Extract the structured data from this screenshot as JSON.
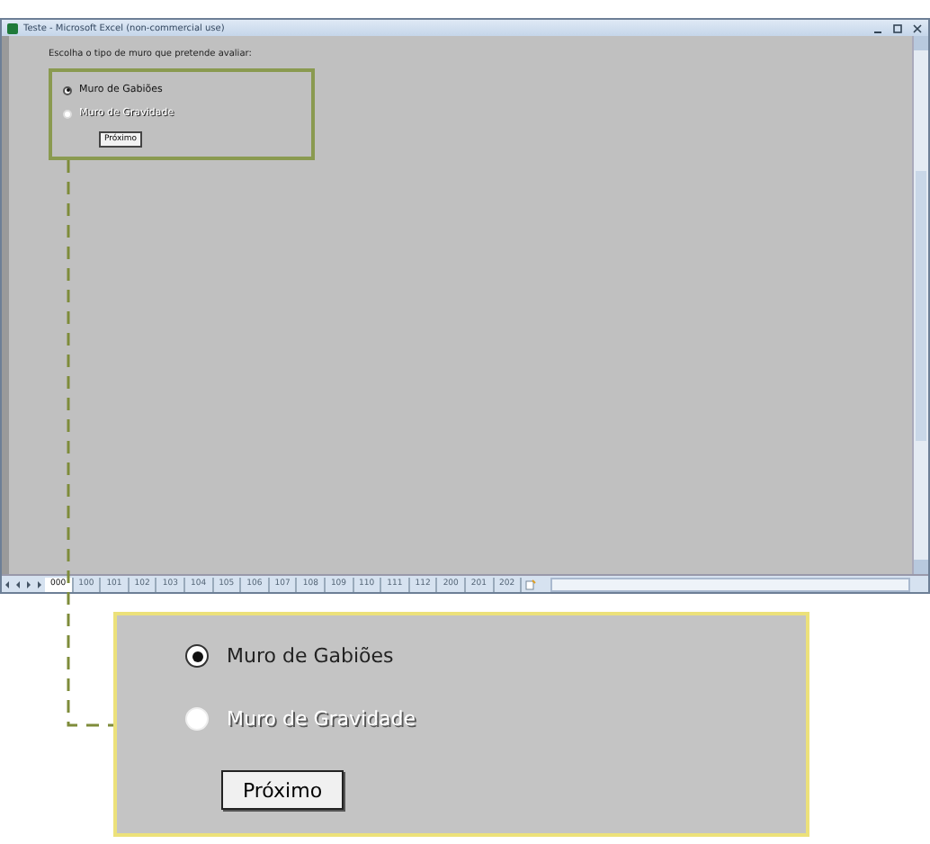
{
  "window": {
    "title": "Teste - Microsoft Excel (non-commercial use)"
  },
  "dialog": {
    "prompt": "Escolha o tipo de muro que pretende avaliar:",
    "options": [
      {
        "label": "Muro de Gabiões",
        "selected": true,
        "disabled": false
      },
      {
        "label": "Muro de Gravidade",
        "selected": false,
        "disabled": true
      }
    ],
    "button": "Próximo"
  },
  "sheet_tabs": [
    {
      "label": "000",
      "selected": true
    },
    {
      "label": "100",
      "selected": false
    },
    {
      "label": "101",
      "selected": false
    },
    {
      "label": "102",
      "selected": false
    },
    {
      "label": "103",
      "selected": false
    },
    {
      "label": "104",
      "selected": false
    },
    {
      "label": "105",
      "selected": false
    },
    {
      "label": "106",
      "selected": false
    },
    {
      "label": "107",
      "selected": false
    },
    {
      "label": "108",
      "selected": false
    },
    {
      "label": "109",
      "selected": false
    },
    {
      "label": "110",
      "selected": false
    },
    {
      "label": "111",
      "selected": false
    },
    {
      "label": "112",
      "selected": false
    },
    {
      "label": "200",
      "selected": false
    },
    {
      "label": "201",
      "selected": false
    },
    {
      "label": "202",
      "selected": false
    }
  ],
  "zoom_inset": {
    "options": [
      {
        "label": "Muro de Gabiões",
        "selected": true,
        "disabled": false
      },
      {
        "label": "Muro de Gravidade",
        "selected": false,
        "disabled": true
      }
    ],
    "button": "Próximo"
  }
}
